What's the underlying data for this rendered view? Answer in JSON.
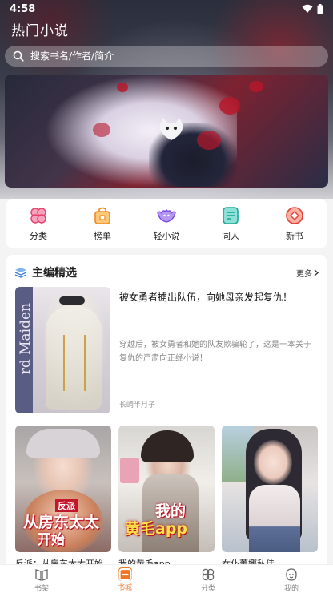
{
  "status": {
    "time": "4:58"
  },
  "header": {
    "title": "热门小说"
  },
  "search": {
    "placeholder": "搜索书名/作者/简介"
  },
  "categories": [
    {
      "label": "分类",
      "icon": "clover-icon",
      "color": "#e23f6c"
    },
    {
      "label": "榜单",
      "icon": "trophy-bag-icon",
      "color": "#f08a1f"
    },
    {
      "label": "轻小说",
      "icon": "bat-icon",
      "color": "#7a4be0"
    },
    {
      "label": "同人",
      "icon": "document-list-icon",
      "color": "#1fa79a"
    },
    {
      "label": "新书",
      "icon": "new-badge-icon",
      "color": "#e2403a"
    }
  ],
  "picks": {
    "title": "主编精选",
    "more": "更多",
    "featured": {
      "cover_text": "rd Maiden",
      "title": "被女勇者掳出队伍，向她母亲发起复仇！",
      "description": "穿越后，被女勇者和她的队友欺骗轮了，这是一本关于复仇的严肃向正经小说！",
      "author": "长崎半月子"
    },
    "books": [
      {
        "name": "反派：从房东太太开始",
        "cover_line1": "反派",
        "cover_line2": "从房东太太",
        "cover_line3": "开始"
      },
      {
        "name": "我的黄毛app",
        "cover_line1": "我的",
        "cover_line2": "黄毛app"
      },
      {
        "name": "女仆蕾娜私佳",
        "cover_line1": ""
      }
    ]
  },
  "nav": [
    {
      "label": "书架",
      "icon": "bookshelf-icon",
      "active": false
    },
    {
      "label": "书城",
      "icon": "bookstore-icon",
      "active": true
    },
    {
      "label": "分类",
      "icon": "category-grid-icon",
      "active": false
    },
    {
      "label": "我的",
      "icon": "profile-icon",
      "active": false
    }
  ],
  "colors": {
    "accent": "#f07623",
    "title_red": "#b80f1f"
  }
}
